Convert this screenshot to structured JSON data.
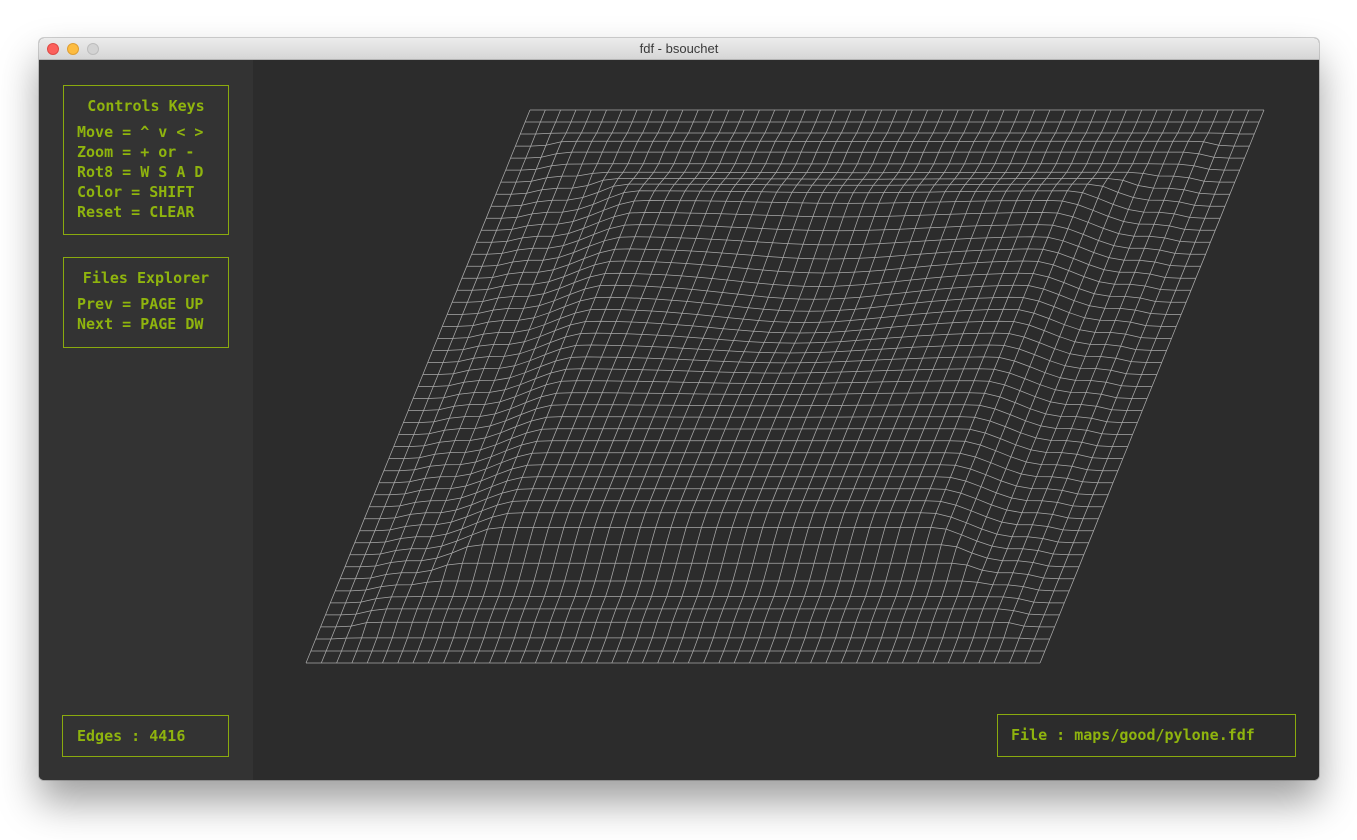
{
  "window": {
    "title": "fdf - bsouchet"
  },
  "controls": {
    "heading": "Controls Keys",
    "lines": [
      "Move = ^ v < >",
      "Zoom = + or -",
      "Rot8 = W S A D",
      "Color = SHIFT",
      "Reset = CLEAR"
    ]
  },
  "files": {
    "heading": "Files Explorer",
    "lines": [
      "Prev = PAGE UP",
      "Next = PAGE DW"
    ]
  },
  "status": {
    "edges": "Edges : 4416",
    "file": "File : maps/good/pylone.fdf"
  },
  "colors": {
    "accent": "#8fb40e",
    "mesh": "#a9a9a9",
    "background": "#2c2c2c",
    "sidebar": "#333333"
  }
}
